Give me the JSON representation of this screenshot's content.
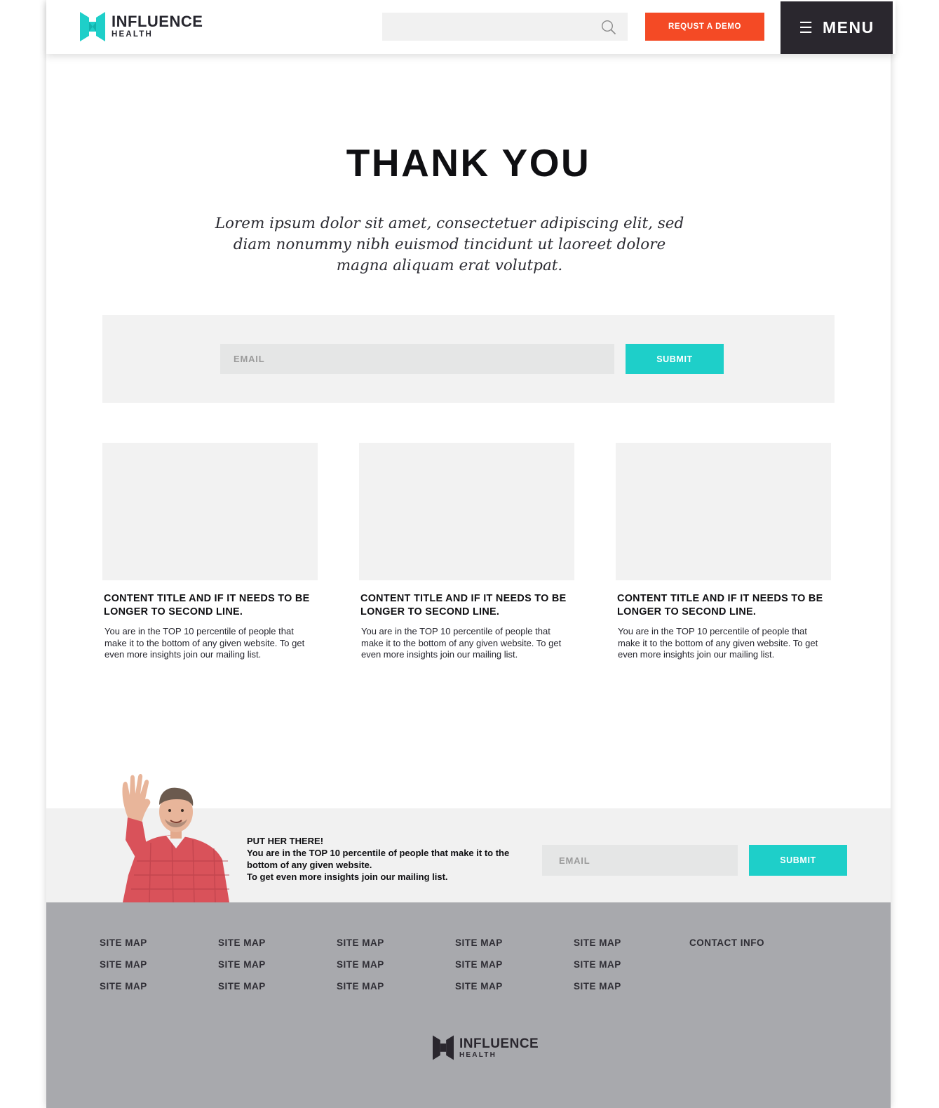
{
  "header": {
    "brand_name": "INFLUENCE",
    "brand_sub": "HEALTH",
    "search_placeholder": "",
    "demo_label": "REQUST A DEMO",
    "menu_label": "MENU",
    "menu_icon": "☰",
    "colors": {
      "brand": "#1ecfc9",
      "demo": "#f44a25",
      "menu_bg": "#2a272e"
    }
  },
  "hero": {
    "title": "THANK YOU",
    "lede": "Lorem ipsum dolor sit amet, consectetuer adipiscing elit, sed diam nonummy nibh euismod tincidunt ut laoreet dolore magna aliquam erat volutpat."
  },
  "signup": {
    "email_placeholder": "EMAIL",
    "submit_label": "SUBMIT"
  },
  "cards": [
    {
      "title": "CONTENT TITLE AND IF IT NEEDS TO BE LONGER TO SECOND LINE.",
      "body": "You are in the TOP 10 percentile of people that make it to the bottom of any given website. To get even more insights join our mailing list."
    },
    {
      "title": "CONTENT TITLE AND IF IT NEEDS TO BE LONGER TO SECOND LINE.",
      "body": "You are in the TOP 10 percentile of people that make it to the bottom of any given website. To get even more insights join our mailing list."
    },
    {
      "title": "CONTENT TITLE AND IF IT NEEDS TO BE LONGER TO SECOND LINE.",
      "body": "You are in the TOP 10 percentile of people that make it to the bottom of any given website. To get even more insights join our mailing list."
    }
  ],
  "promo": {
    "heading": "PUT HER THERE!",
    "line1": "You are in the TOP 10 percentile of people that make it to the bottom of any given website.",
    "line2": "To get even more insights join our mailing list.",
    "email_placeholder": "EMAIL",
    "submit_label": "SUBMIT"
  },
  "footer": {
    "columns": [
      [
        "SITE MAP",
        "SITE MAP",
        "SITE MAP"
      ],
      [
        "SITE MAP",
        "SITE MAP",
        "SITE MAP"
      ],
      [
        "SITE MAP",
        "SITE MAP",
        "SITE MAP"
      ],
      [
        "SITE MAP",
        "SITE MAP",
        "SITE MAP"
      ],
      [
        "SITE MAP",
        "SITE MAP",
        "SITE MAP"
      ],
      [
        "CONTACT INFO"
      ]
    ],
    "brand_name": "INFLUENCE",
    "brand_sub": "HEALTH"
  }
}
